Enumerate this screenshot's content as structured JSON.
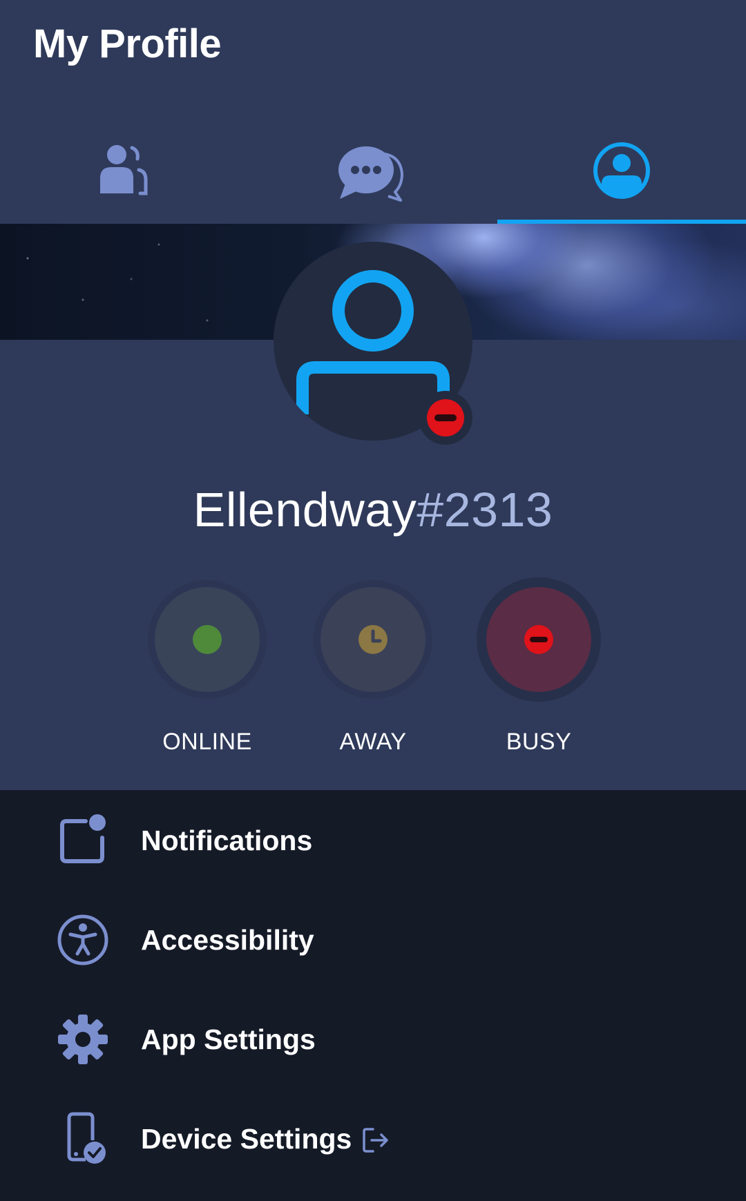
{
  "header": {
    "title": "My Profile",
    "tabs": [
      {
        "name": "friends",
        "icon": "friends-icon",
        "active": false
      },
      {
        "name": "messages",
        "icon": "chat-bubbles-icon",
        "active": false
      },
      {
        "name": "profile",
        "icon": "profile-icon",
        "active": true
      }
    ]
  },
  "profile": {
    "username": "Ellendway",
    "tag": "#2313",
    "current_status": "busy"
  },
  "status_options": [
    {
      "label": "ONLINE",
      "color": "#4e8a3a",
      "selected": false
    },
    {
      "label": "AWAY",
      "color": "#8c7845",
      "selected": false
    },
    {
      "label": "BUSY",
      "color": "#e0121a",
      "selected": true
    }
  ],
  "menu": [
    {
      "label": "Notifications",
      "icon": "notification-icon"
    },
    {
      "label": "Accessibility",
      "icon": "accessibility-icon"
    },
    {
      "label": "App Settings",
      "icon": "gear-icon"
    },
    {
      "label": "Device Settings",
      "icon": "device-settings-icon",
      "external": true
    }
  ],
  "colors": {
    "accent": "#12a4f2",
    "header_bg": "#2f3a5a",
    "menu_bg": "#151a27",
    "icon_muted": "#7b8fcf",
    "busy": "#e0121a"
  }
}
